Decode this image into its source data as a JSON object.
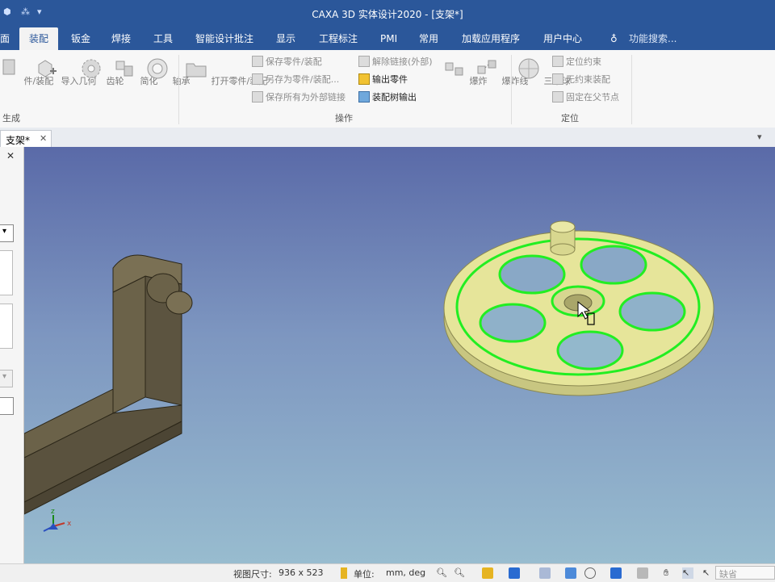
{
  "app": {
    "title": "CAXA 3D 实体设计2020 - [支架*]"
  },
  "menu": {
    "tabs": [
      {
        "label": "面"
      },
      {
        "label": "装配",
        "active": true
      },
      {
        "label": "钣金"
      },
      {
        "label": "焊接"
      },
      {
        "label": "工具"
      },
      {
        "label": "智能设计批注"
      },
      {
        "label": "显示"
      },
      {
        "label": "工程标注"
      },
      {
        "label": "PMI"
      },
      {
        "label": "常用"
      },
      {
        "label": "加载应用程序"
      },
      {
        "label": "用户中心"
      }
    ],
    "search_label": "功能搜索..."
  },
  "ribbon": {
    "group_generate": {
      "label": "生成",
      "buttons": [
        "件/装配",
        "导入几何",
        "齿轮",
        "简化",
        "轴承"
      ]
    },
    "group_operate": {
      "label": "操作",
      "open_button": "打开零件/装配",
      "save_part": "保存零件/装配",
      "save_as": "另存为零件/装配...",
      "save_all_external": "保存所有为外部链接",
      "unlink_external": "解除链接(外部)",
      "export_part": "输出零件",
      "export_tree": "装配树输出",
      "explode": "爆炸",
      "explode_line": "爆炸线"
    },
    "group_position": {
      "label": "定位",
      "triball": "三维球",
      "locate_constraint": "定位约束",
      "unconstrained_assembly": "无约束装配",
      "fix_at_parent": "固定在父节点"
    }
  },
  "document": {
    "tab_label": "支架*",
    "close_glyph": "✕",
    "overflow_glyph": "▾"
  },
  "axis": {
    "z": "z",
    "x": "x"
  },
  "status": {
    "view_size_label": "视图尺寸:",
    "view_size_value": "936 x 523",
    "units_label": "单位:",
    "units_value": "mm, deg",
    "default_label": "缺省"
  },
  "colors": {
    "titlebar": "#2b579a",
    "wheel_fill": "#e6e59a",
    "wheel_highlight": "#22ee22",
    "bracket_fill": "#6b6249"
  }
}
